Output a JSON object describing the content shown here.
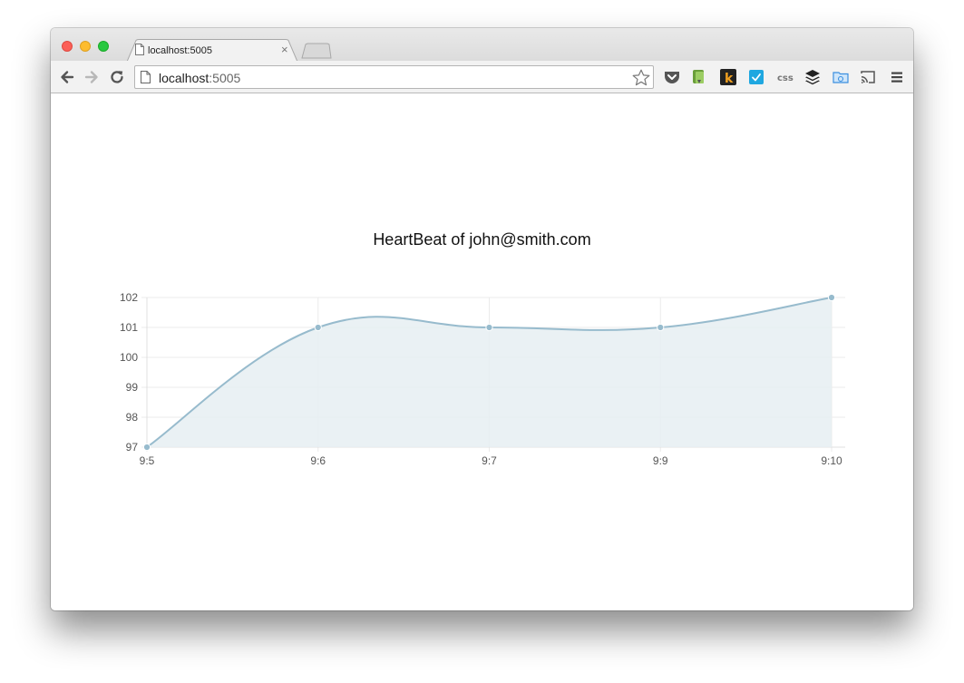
{
  "browser": {
    "tab_title": "localhost:5005",
    "tab_close": "×",
    "url_host": "localhost",
    "url_port": ":5005",
    "extensions": [
      "pocket-icon",
      "evernote-icon",
      "k-icon",
      "todo-check-icon",
      "css-icon",
      "buffer-icon",
      "folder-icon",
      "cast-icon",
      "menu-icon"
    ],
    "extension_css_label": "css",
    "extension_k_label": "k"
  },
  "chart_data": {
    "type": "line",
    "title": "HeartBeat of john@smith.com",
    "categories": [
      "9:5",
      "9:6",
      "9:7",
      "9:9",
      "9:10"
    ],
    "series": [
      {
        "values": [
          97,
          101,
          101,
          101,
          102
        ]
      }
    ],
    "ylim": [
      97,
      102
    ],
    "yticks": [
      "97",
      "98",
      "99",
      "100",
      "101",
      "102"
    ],
    "fill": true,
    "smooth": true,
    "grid": true,
    "colors": {
      "line": "#97bbcd",
      "fill": "#e6eef2",
      "point": "#97bbcd",
      "grid": "#ebebeb",
      "tick_text": "#555555"
    }
  }
}
